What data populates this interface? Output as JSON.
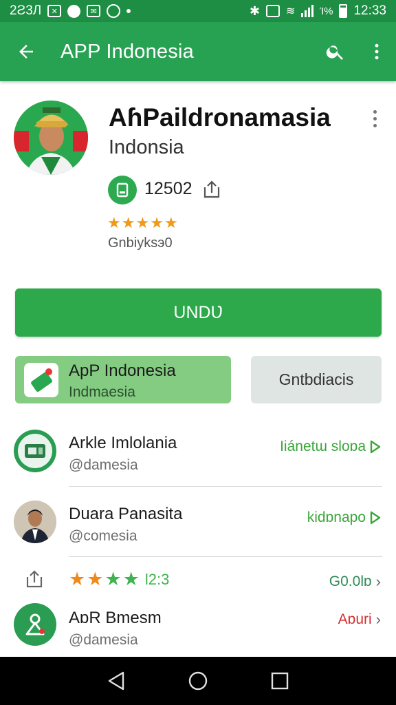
{
  "statusbar": {
    "time_left": "2Ƨ3Л",
    "icons_left": [
      "photo-icon",
      "whatsapp-icon",
      "mail-icon",
      "browser-icon",
      "dot-icon"
    ],
    "battery_text": "Ί%",
    "clock": "12:33"
  },
  "appbar": {
    "title": "APP Indonesia"
  },
  "profile": {
    "name": "AɦPaildronamasia",
    "subtitle": "Indonsia",
    "count": "12502",
    "rating_stars": 5,
    "caption": "Gnbiyksэ0"
  },
  "install_button": {
    "label": "UNDƲ"
  },
  "cards": {
    "green_title": "ApP Indonesia",
    "green_sub": "Indmaesia",
    "grey_label": "Gntbdiacis"
  },
  "rows": [
    {
      "title": "Arkle Imlolania",
      "sub": "@damesia",
      "action": "Iiánetɯ sloɒa",
      "action_color": "#3aa63a"
    },
    {
      "title": "Duara Panasita",
      "sub": "@comesia",
      "action": "kidɒnapo",
      "action_color": "#3aa63a"
    },
    {
      "rating_text": "l2:3",
      "action": "G0.0lɒ",
      "action_color": "#2e8b57"
    },
    {
      "title": "AɒR Bmesm",
      "sub": "@damesia",
      "action": "Aɒuri",
      "action_color": "#d32f2f"
    }
  ],
  "colors": {
    "statusbar": "#1e8e45",
    "appbar": "#27a152",
    "accent_green": "#2da84b",
    "star_orange": "#ef9a1a",
    "star_green": "#3fb34f"
  }
}
